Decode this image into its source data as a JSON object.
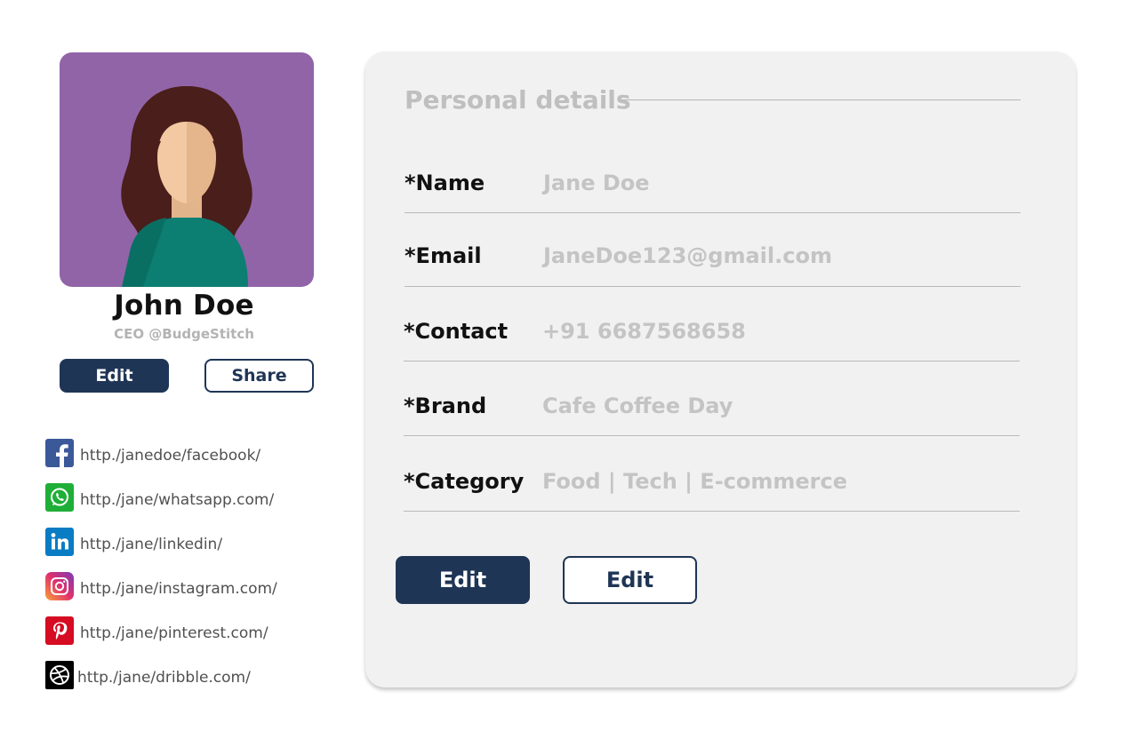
{
  "profile": {
    "name": "John Doe",
    "role": "CEO @BudgeStitch",
    "edit_label": "Edit",
    "share_label": "Share"
  },
  "social": [
    {
      "icon": "facebook-icon",
      "url": "http./janedoe/facebook/",
      "color": "#3b5998"
    },
    {
      "icon": "whatsapp-icon",
      "url": "http./jane/whatsapp.com/",
      "color": "#1faf38"
    },
    {
      "icon": "linkedin-icon",
      "url": "http./jane/linkedin/",
      "color": "#0a7cc4"
    },
    {
      "icon": "instagram-icon",
      "url": "http./jane/instagram.com/",
      "color": "#e1306c"
    },
    {
      "icon": "pinterest-icon",
      "url": "http./jane/pinterest.com/",
      "color": "#d50c22"
    },
    {
      "icon": "dribbble-icon",
      "url": "http./jane/dribble.com/",
      "color": "#000000"
    }
  ],
  "details": {
    "title": "Personal details",
    "fields": [
      {
        "label": "*Name",
        "value": "Jane Doe"
      },
      {
        "label": "*Email",
        "value": "JaneDoe123@gmail.com"
      },
      {
        "label": "*Contact",
        "value": "+91 6687568658"
      },
      {
        "label": "*Brand",
        "value": "Cafe Coffee Day"
      },
      {
        "label": "*Category",
        "value": "Food | Tech | E-commerce"
      }
    ],
    "primary_button_label": "Edit",
    "secondary_button_label": "Edit"
  },
  "colors": {
    "accent": "#1f3555",
    "avatar_bg": "#9164a8",
    "card_bg": "#f1f1f1",
    "muted_text": "#c4c4c4"
  }
}
